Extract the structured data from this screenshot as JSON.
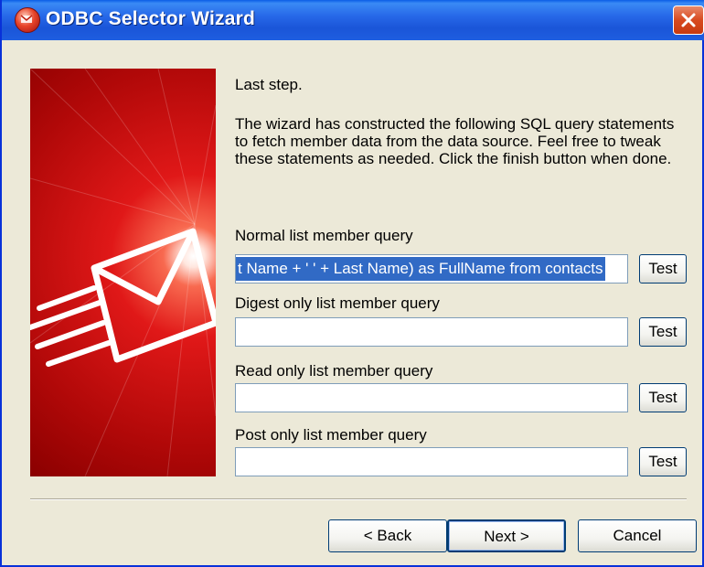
{
  "window": {
    "title": "ODBC Selector Wizard"
  },
  "intro": {
    "heading": "Last step.",
    "body": "The wizard has constructed the following SQL query statements to fetch member data from the data source.  Feel free to tweak these statements as needed.  Click the finish button when done."
  },
  "queries": [
    {
      "label": "Normal list member query",
      "value": "t Name + ' ' + Last Name) as FullName from contacts",
      "test_label": "Test"
    },
    {
      "label": "Digest only list member query",
      "value": "",
      "test_label": "Test"
    },
    {
      "label": "Read only list member query",
      "value": "",
      "test_label": "Test"
    },
    {
      "label": "Post only list member query",
      "value": "",
      "test_label": "Test"
    }
  ],
  "buttons": {
    "back": "< Back",
    "next": "Next >",
    "cancel": "Cancel"
  },
  "colors": {
    "titlebar": "#2768e8",
    "selection": "#316ac5",
    "banner_red": "#e01818",
    "dialog_bg": "#ece9d8"
  }
}
